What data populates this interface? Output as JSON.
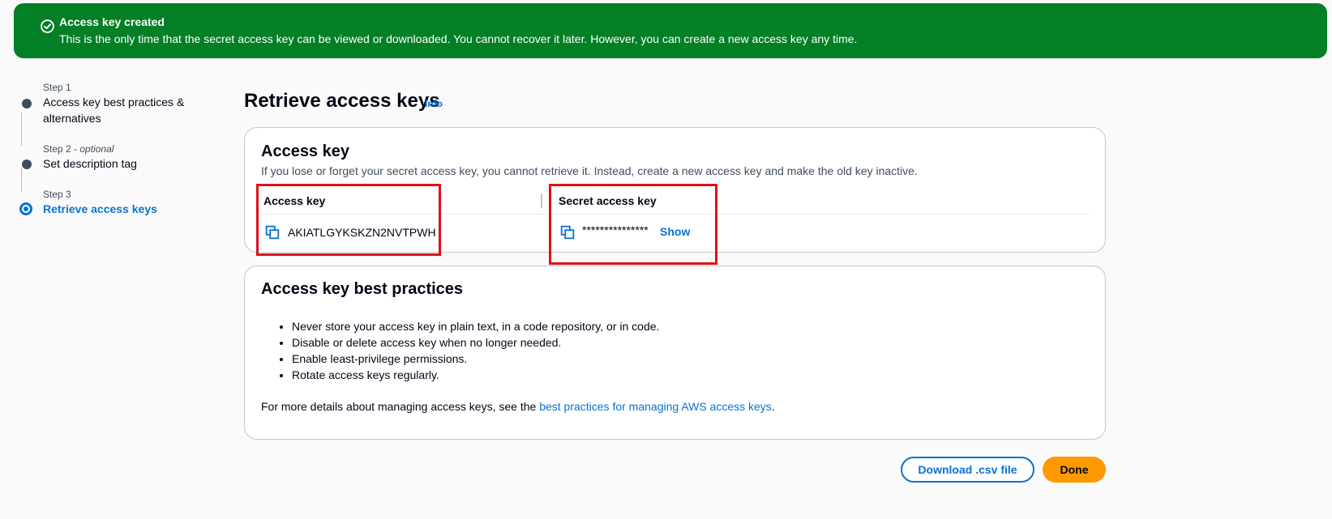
{
  "flash": {
    "title": "Access key created",
    "message": "This is the only time that the secret access key can be viewed or downloaded. You cannot recover it later. However, you can create a new access key any time.",
    "icon": "check-circle-icon",
    "color": "#037f25"
  },
  "steps": [
    {
      "number": "Step 1",
      "optional": "",
      "title": "Access key best practices &",
      "title2": "alternatives"
    },
    {
      "number": "Step 2",
      "optional": "optional",
      "title": "Set description tag"
    },
    {
      "number": "Step 3",
      "optional": "",
      "title": "Retrieve access keys",
      "active": true
    }
  ],
  "page": {
    "title": "Retrieve access keys",
    "info": "Info"
  },
  "access_key_card": {
    "title": "Access key",
    "description": "If you lose or forget your secret access key, you cannot retrieve it. Instead, create a new access key and make the old key inactive.",
    "col_access_key": "Access key",
    "col_secret": "Secret access key",
    "access_key_value": "AKIATLGYKSKZN2NVTPWH",
    "secret_value": "***************",
    "show": "Show"
  },
  "best_practices": {
    "title": "Access key best practices",
    "items": [
      "Never store your access key in plain text, in a code repository, or in code.",
      "Disable or delete access key when no longer needed.",
      "Enable least-privilege permissions.",
      "Rotate access keys regularly."
    ],
    "footer_prefix": "For more details about managing access keys, see the ",
    "footer_link": "best practices for managing AWS access keys",
    "footer_suffix": "."
  },
  "buttons": {
    "download": "Download .csv file",
    "done": "Done"
  },
  "colors": {
    "accent": "#0972d3",
    "primary_button": "#ff9900",
    "highlight": "#e0101b"
  }
}
